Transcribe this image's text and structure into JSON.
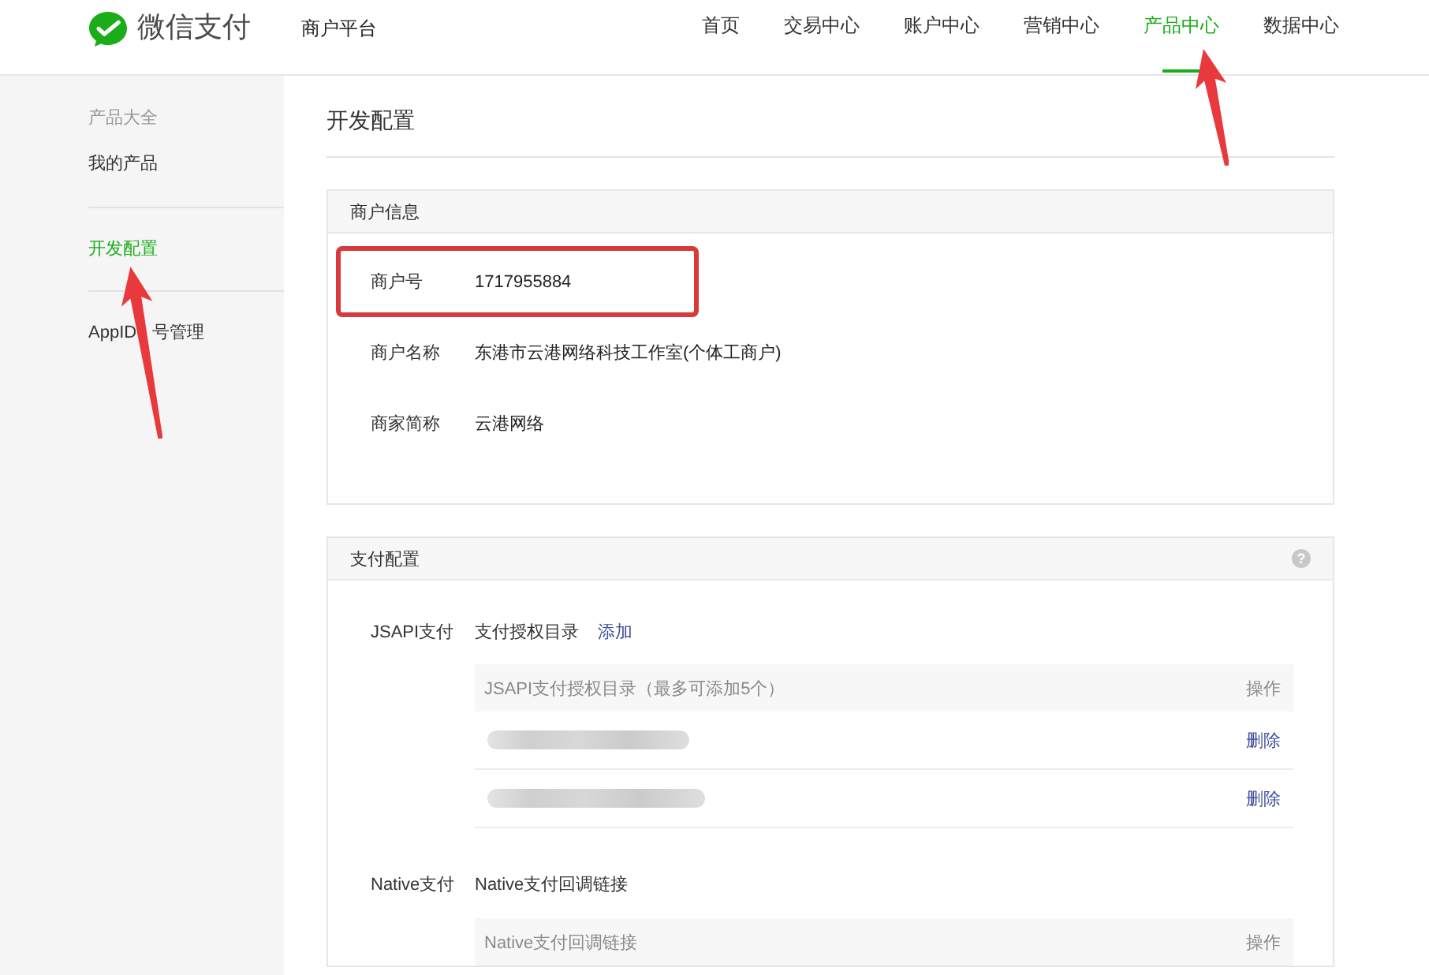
{
  "header": {
    "brand": "微信支付",
    "platform": "商户平台",
    "nav": [
      {
        "label": "首页",
        "selected": false
      },
      {
        "label": "交易中心",
        "selected": false
      },
      {
        "label": "账户中心",
        "selected": false
      },
      {
        "label": "营销中心",
        "selected": false
      },
      {
        "label": "产品中心",
        "selected": true
      },
      {
        "label": "数据中心",
        "selected": false
      }
    ]
  },
  "sidebar": {
    "group_title": "产品大全",
    "items": [
      {
        "label_parts": [
          "我的产品"
        ],
        "selected": false
      },
      {
        "label_parts": [
          "开发配置"
        ],
        "selected": true
      },
      {
        "label_parts": [
          "AppID",
          "号管理"
        ],
        "selected": false
      }
    ]
  },
  "page_title": "开发配置",
  "merchant_info": {
    "title": "商户信息",
    "rows": [
      {
        "label": "商户号",
        "value": "1717955884",
        "highlighted": true
      },
      {
        "label": "商户名称",
        "value": "东港市云港网络科技工作室(个体工商户)",
        "highlighted": false
      },
      {
        "label": "商家简称",
        "value": "云港网络",
        "highlighted": false
      }
    ]
  },
  "payment_config": {
    "title": "支付配置",
    "help": "?",
    "sections": [
      {
        "label": "JSAPI支付",
        "subtitle": "支付授权目录",
        "link": "添加",
        "table": {
          "columns": [
            "JSAPI支付授权目录（最多可添加5个）",
            "操作"
          ],
          "rows": [
            {
              "action": "删除"
            },
            {
              "action": "删除"
            }
          ]
        }
      },
      {
        "label": "Native支付",
        "subtitle": "Native支付回调链接",
        "table": {
          "columns": [
            "Native支付回调链接",
            "操作"
          ]
        }
      }
    ]
  }
}
